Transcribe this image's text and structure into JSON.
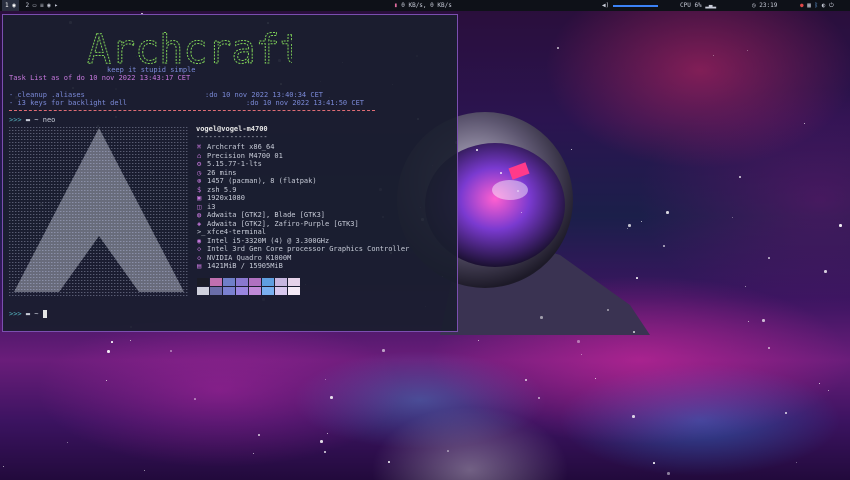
{
  "topbar": {
    "workspaces": [
      "1",
      "2"
    ],
    "net_speed": "0 KB/s, 0 KB/s",
    "cpu": "CPU 6%",
    "time": "23:19",
    "colors": {
      "accent": "#3b82f6",
      "bg": "#0e1118"
    }
  },
  "terminal": {
    "logo_text": "Archcraft",
    "tagline": "keep it stupid simple",
    "task_header_prefix": "Task List as of ",
    "task_header_date": "do 10 nov 2022 13:43:17 CET",
    "tasks": [
      {
        "text": "- cleanup .aliases",
        "date": ":do 10 nov 2022 13:40:34 CET"
      },
      {
        "text": "- i3 keys for backlight dell",
        "date": ":do 10 nov 2022 13:41:50 CET"
      }
    ],
    "prompt1": ">>> ",
    "prompt1_path": "~ neo",
    "user_host": "vogel@vogel-m4700",
    "separator": "-----------------",
    "info": [
      {
        "icon": "arch-icon",
        "glyph": "⌘",
        "value": "Archcraft x86_64"
      },
      {
        "icon": "laptop-icon",
        "glyph": "⌂",
        "value": "Precision M4700 01"
      },
      {
        "icon": "kernel-icon",
        "glyph": "⚙",
        "value": "5.15.77-1-lts"
      },
      {
        "icon": "clock-icon",
        "glyph": "◷",
        "value": "26 mins"
      },
      {
        "icon": "package-icon",
        "glyph": "⊛",
        "value": "1457 (pacman), 8 (flatpak)"
      },
      {
        "icon": "shell-icon",
        "glyph": "$",
        "value": "zsh 5.9"
      },
      {
        "icon": "display-icon",
        "glyph": "▣",
        "value": "1920x1080"
      },
      {
        "icon": "wm-icon",
        "glyph": "◫",
        "value": "i3"
      },
      {
        "icon": "theme-icon",
        "glyph": "◍",
        "value": "Adwaita [GTK2], Blade [GTK3]"
      },
      {
        "icon": "icons-icon",
        "glyph": "◈",
        "value": "Adwaita [GTK2], Zafiro-Purple [GTK3]"
      },
      {
        "icon": "terminal-icon",
        "glyph": ">_",
        "value": "xfce4-terminal"
      },
      {
        "icon": "cpu-icon",
        "glyph": "◉",
        "value": "Intel i5-3320M (4) @ 3.300GHz"
      },
      {
        "icon": "gpu-icon",
        "glyph": "◇",
        "value": "Intel 3rd Gen Core processor Graphics Controller"
      },
      {
        "icon": "gpu-icon",
        "glyph": "◇",
        "value": "NVIDIA Quadro K1000M"
      },
      {
        "icon": "memory-icon",
        "glyph": "▤",
        "value": "1421MiB / 15905MiB"
      }
    ],
    "swatches": [
      "#1a1b26",
      "#c070b0",
      "#6f7fc8",
      "#8a78d0",
      "#b071c0",
      "#5f9fe0",
      "#c7b6e0",
      "#e6d3ea",
      "#cfd0dc",
      "#6a6da8",
      "#7a80d0",
      "#9a86e0",
      "#c08ad8",
      "#7ab0f0",
      "#d8c8ee",
      "#f4eaf6"
    ],
    "prompt2": ">>> ",
    "prompt2_path": "~"
  }
}
